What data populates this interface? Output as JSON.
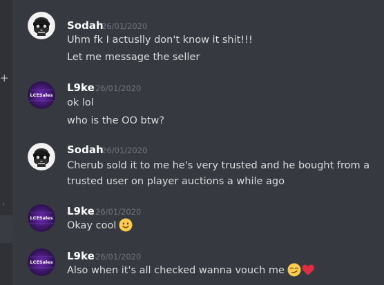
{
  "top_fragment": "",
  "messages": [
    {
      "author": "Sodah",
      "timestamp": "26/01/2020",
      "avatar": "skull-avatar",
      "lines": [
        "Uhm fk I actuslly don't know it shit!!!",
        "Let me message the seller"
      ]
    },
    {
      "author": "L9ke",
      "timestamp": "26/01/2020",
      "avatar": "LCESales",
      "lines": [
        "ok lol",
        "who is the OO btw?"
      ]
    },
    {
      "author": "Sodah",
      "timestamp": "26/01/2020",
      "avatar": "skull-avatar",
      "lines": [
        "Cherub sold it to me he's very trusted and he bought from a",
        "trusted user on player auctions a while ago"
      ]
    },
    {
      "author": "L9ke",
      "timestamp": "26/01/2020",
      "avatar": "LCESales",
      "lines": [
        "Okay cool"
      ],
      "emojis": [
        "slightly-smiling-face-emoji"
      ]
    },
    {
      "author": "L9ke",
      "timestamp": "26/01/2020",
      "avatar": "LCESales",
      "lines": [
        "Also when it's all checked wanna vouch me"
      ],
      "emojis": [
        "smirking-face-emoji",
        "red-heart-emoji"
      ]
    }
  ],
  "sidebar": {
    "add_icon": "+"
  },
  "colors": {
    "background": "#36393f",
    "sidebar": "#2f3136",
    "author": "#ffffff",
    "text": "#dcddde",
    "timestamp": "#72767d",
    "lcesales_bg": "#4a1a7a"
  }
}
